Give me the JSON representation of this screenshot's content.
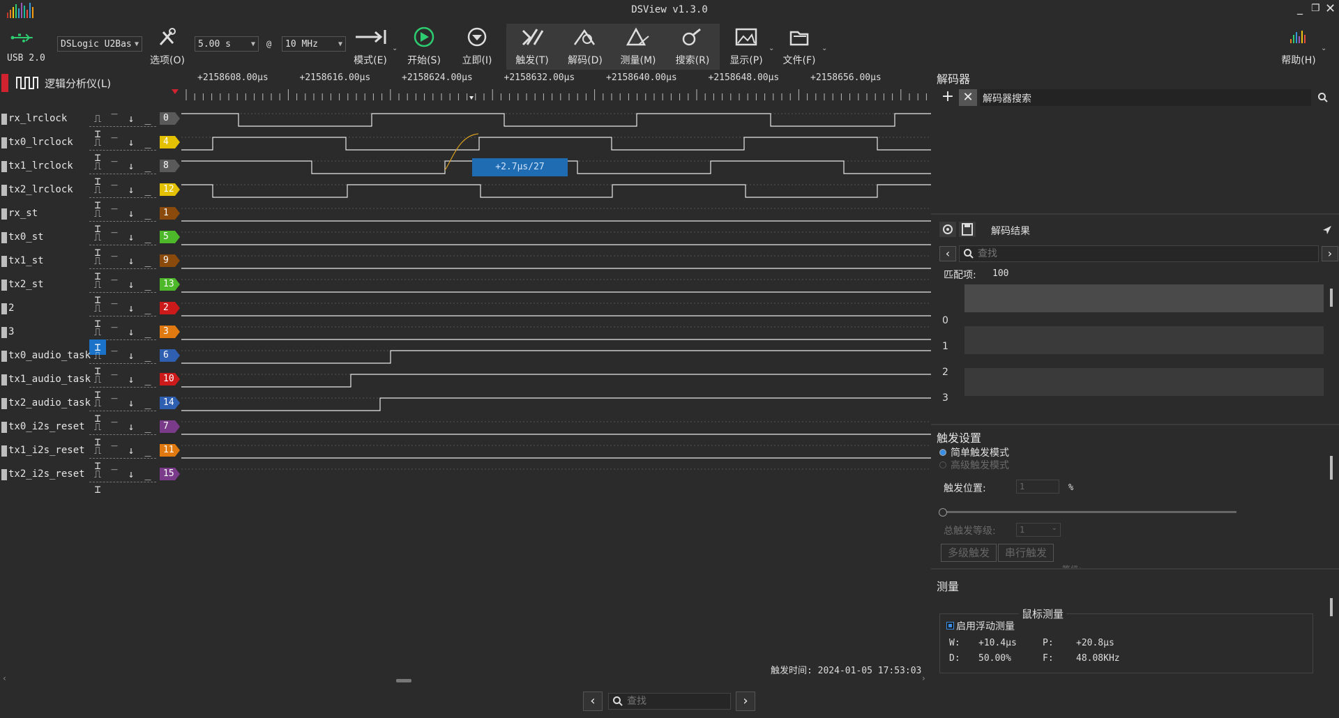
{
  "window": {
    "title": "DSView v1.3.0",
    "min": "_",
    "restore": "❐",
    "close": "✕"
  },
  "toolbar": {
    "usb_label": "USB 2.0",
    "device": "DSLogic U2Bas",
    "duration": "5.00 s",
    "at": "@",
    "samplerate": "10 MHz",
    "options": "选项(O)",
    "mode": "模式(E)",
    "start": "开始(S)",
    "instant": "立即(I)",
    "trigger": "触发(T)",
    "decode": "解码(D)",
    "measure": "测量(M)",
    "search": "搜索(R)",
    "display": "显示(P)",
    "file": "文件(F)",
    "help": "帮助(H)"
  },
  "analyzer": {
    "title": "逻辑分析仪(L)",
    "ruler_labels": [
      "+2158608.00μs",
      "+2158616.00μs",
      "+2158624.00μs",
      "+2158632.00μs",
      "+2158640.00μs",
      "+2158648.00μs",
      "+2158656.00μs"
    ],
    "cursor_label": "+2.7μs/27",
    "trigger_time_label": "触发时间: 2024-01-05 17:53:03",
    "trigger_glyphs": [
      "⎍",
      "‾",
      "↓",
      "_",
      "⌶"
    ],
    "channels": [
      {
        "name": "rx_lrclock",
        "index": "0",
        "color": "#5a5a5a"
      },
      {
        "name": "tx0_lrclock",
        "index": "4",
        "color": "#e3c000"
      },
      {
        "name": "tx1_lrclock",
        "index": "8",
        "color": "#5a5a5a"
      },
      {
        "name": "tx2_lrclock",
        "index": "12",
        "color": "#e3c000"
      },
      {
        "name": "rx_st",
        "index": "1",
        "color": "#8a4a0c"
      },
      {
        "name": "tx0_st",
        "index": "5",
        "color": "#4cb82a"
      },
      {
        "name": "tx1_st",
        "index": "9",
        "color": "#8a4a0c"
      },
      {
        "name": "tx2_st",
        "index": "13",
        "color": "#4cb82a"
      },
      {
        "name": "2",
        "index": "2",
        "color": "#cc1a1a"
      },
      {
        "name": "3",
        "index": "3",
        "color": "#e07a10"
      },
      {
        "name": "tx0_audio_task",
        "index": "6",
        "color": "#2f5fb0"
      },
      {
        "name": "tx1_audio_task",
        "index": "10",
        "color": "#cc1a1a"
      },
      {
        "name": "tx2_audio_task",
        "index": "14",
        "color": "#2f5fb0"
      },
      {
        "name": "tx0_i2s_reset",
        "index": "7",
        "color": "#7a3b8a"
      },
      {
        "name": "tx1_i2s_reset",
        "index": "11",
        "color": "#e07a10"
      },
      {
        "name": "tx2_i2s_reset",
        "index": "15",
        "color": "#7a3b8a"
      }
    ]
  },
  "decoder": {
    "title": "解码器",
    "search_label": "解码器搜索",
    "results_title": "解码结果",
    "find_placeholder": "查找",
    "matches_label": "匹配项:",
    "matches_value": "100",
    "rows": [
      "0",
      "1",
      "2",
      "3"
    ]
  },
  "trigger_settings": {
    "title": "触发设置",
    "simple_mode": "简单触发模式",
    "advanced_mode": "高级触发模式",
    "position_label": "触发位置:",
    "position_value": "1",
    "position_unit": "%",
    "level_label": "总触发等级:",
    "level_value": "1",
    "multi_btn": "多级触发",
    "serial_btn": "串行触发",
    "stage_hint": "等级:"
  },
  "measure": {
    "title": "测量",
    "mouse_title": "鼠标测量",
    "float_label": "启用浮动测量",
    "w_label": "W:",
    "w_value": "+10.4μs",
    "p_label": "P:",
    "p_value": "+20.8μs",
    "d_label": "D:",
    "d_value": "50.00%",
    "f_label": "F:",
    "f_value": "48.08KHz"
  },
  "bottom": {
    "find_placeholder": "查找"
  }
}
